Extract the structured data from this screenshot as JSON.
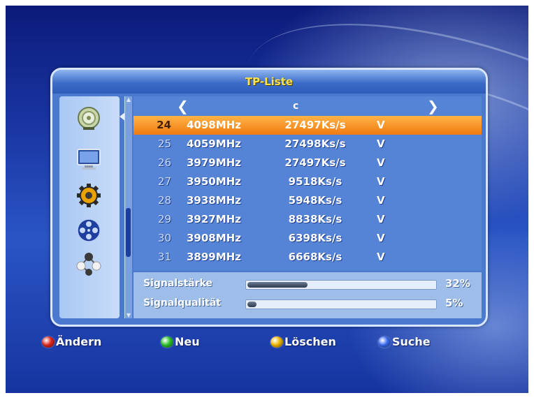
{
  "panel": {
    "title": "TP-Liste"
  },
  "navigation": {
    "left_arrow": "❮",
    "right_arrow": "❯",
    "satellite": "c"
  },
  "transponders": [
    {
      "num": "24",
      "freq": "4098MHz",
      "symbol_rate": "27497Ks/s",
      "pol": "V",
      "selected": true
    },
    {
      "num": "25",
      "freq": "4059MHz",
      "symbol_rate": "27498Ks/s",
      "pol": "V"
    },
    {
      "num": "26",
      "freq": "3979MHz",
      "symbol_rate": "27497Ks/s",
      "pol": "V"
    },
    {
      "num": "27",
      "freq": "3950MHz",
      "symbol_rate": "9518Ks/s",
      "pol": "V"
    },
    {
      "num": "28",
      "freq": "3938MHz",
      "symbol_rate": "5948Ks/s",
      "pol": "V"
    },
    {
      "num": "29",
      "freq": "3927MHz",
      "symbol_rate": "8838Ks/s",
      "pol": "V"
    },
    {
      "num": "30",
      "freq": "3908MHz",
      "symbol_rate": "6398Ks/s",
      "pol": "V"
    },
    {
      "num": "31",
      "freq": "3899MHz",
      "symbol_rate": "6668Ks/s",
      "pol": "V"
    }
  ],
  "signal": {
    "strength_label": "Signalstärke",
    "strength_value": "32%",
    "strength_fraction": 0.32,
    "quality_label": "Signalqualität",
    "quality_value": "5%",
    "quality_fraction": 0.05
  },
  "sidebar": {
    "icons": [
      "satellite-dish-icon",
      "tv-monitor-icon",
      "gear-icon",
      "film-reel-icon",
      "connection-nodes-icon"
    ]
  },
  "footer": {
    "red_label": "Ändern",
    "green_label": "Neu",
    "yellow_label": "Löschen",
    "blue_label": "Suche"
  },
  "colors": {
    "red": "#e0261e",
    "green": "#2fc22a",
    "yellow": "#f2b800",
    "blue": "#3a6af0",
    "selected_row": "#f08a1e",
    "title_text": "#ffe14a"
  }
}
